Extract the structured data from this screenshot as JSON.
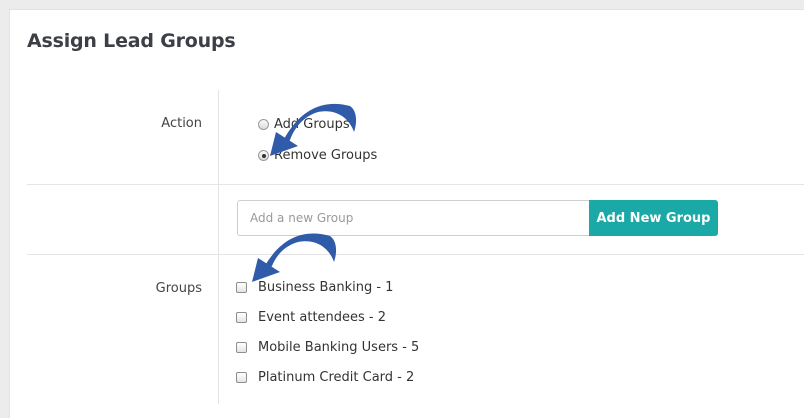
{
  "page": {
    "title": "Assign Lead Groups"
  },
  "action": {
    "label": "Action",
    "options": [
      {
        "label": "Add Groups",
        "selected": false
      },
      {
        "label": "Remove Groups",
        "selected": true
      }
    ]
  },
  "new_group": {
    "placeholder": "Add a new Group",
    "button_label": "Add New Group",
    "button_color": "#1aa9a6"
  },
  "groups": {
    "label": "Groups",
    "items": [
      {
        "label": "Business Banking - 1",
        "checked": false
      },
      {
        "label": "Event attendees - 2",
        "checked": false
      },
      {
        "label": "Mobile Banking Users - 5",
        "checked": false
      },
      {
        "label": "Platinum Credit Card - 2",
        "checked": false
      }
    ]
  },
  "annotation_color": "#2f5ba8"
}
